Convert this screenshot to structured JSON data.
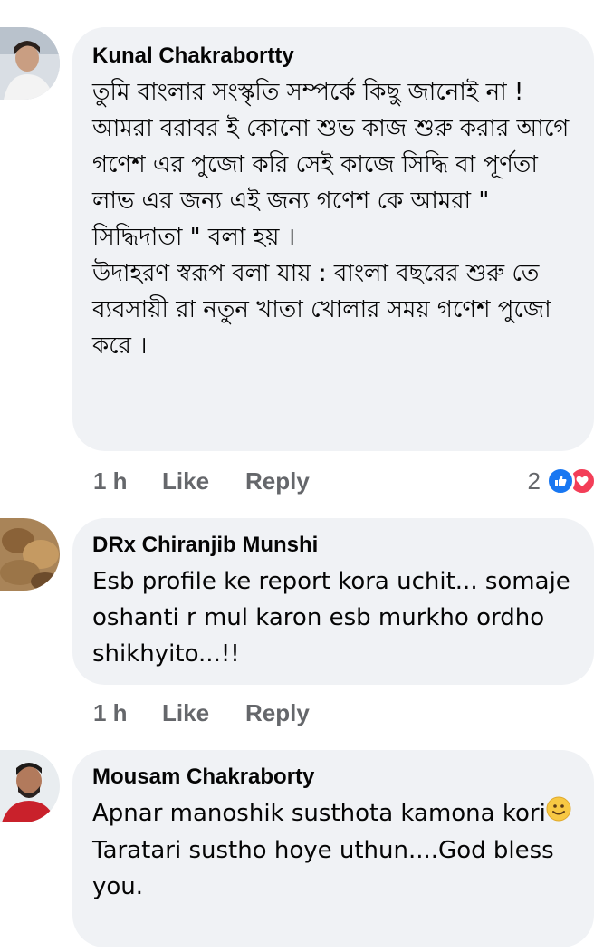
{
  "comments": [
    {
      "author": "Kunal Chakrabortty",
      "lines": [
        "তুমি বাংলার সংস্কৃতি সম্পর্কে কিছু জানোই না !",
        "আমরা বরাবর ই কোনো শুভ কাজ শুরু করার আগে গণেশ এর পুজো করি সেই কাজে সিদ্ধি বা পূর্ণতা লাভ এর জন্য এই জন্য গণেশ কে আমরা \" সিদ্ধিদাতা \" বলা হয় ।",
        "উদাহরণ স্বরূপ বলা যায় : বাংলা বছরের শুরু তে ব্যবসায়ী রা নতুন খাতা খোলার সময় গণেশ পুজো করে ।"
      ],
      "time": "1 h",
      "like_label": "Like",
      "reply_label": "Reply",
      "reaction_count": "2",
      "reactions": [
        "like-icon",
        "love-icon"
      ]
    },
    {
      "author": "DRx Chiranjib Munshi",
      "lines": [
        "Esb profile ke report kora uchit... somaje oshanti r mul karon esb murkho ordho shikhyito...!!"
      ],
      "time": "1 h",
      "like_label": "Like",
      "reply_label": "Reply"
    },
    {
      "author": "Mousam Chakraborty",
      "lines": [
        "Apnar manoshik susthota kamona kori",
        "Taratari sustho hoye uthun....God bless you."
      ],
      "emoji": "slightly-smiling-face-emoji"
    }
  ],
  "colors": {
    "bubble": "#f0f2f5",
    "meta_text": "#65676b",
    "like_blue": "#1877f2",
    "love_red": "#f33e58"
  }
}
